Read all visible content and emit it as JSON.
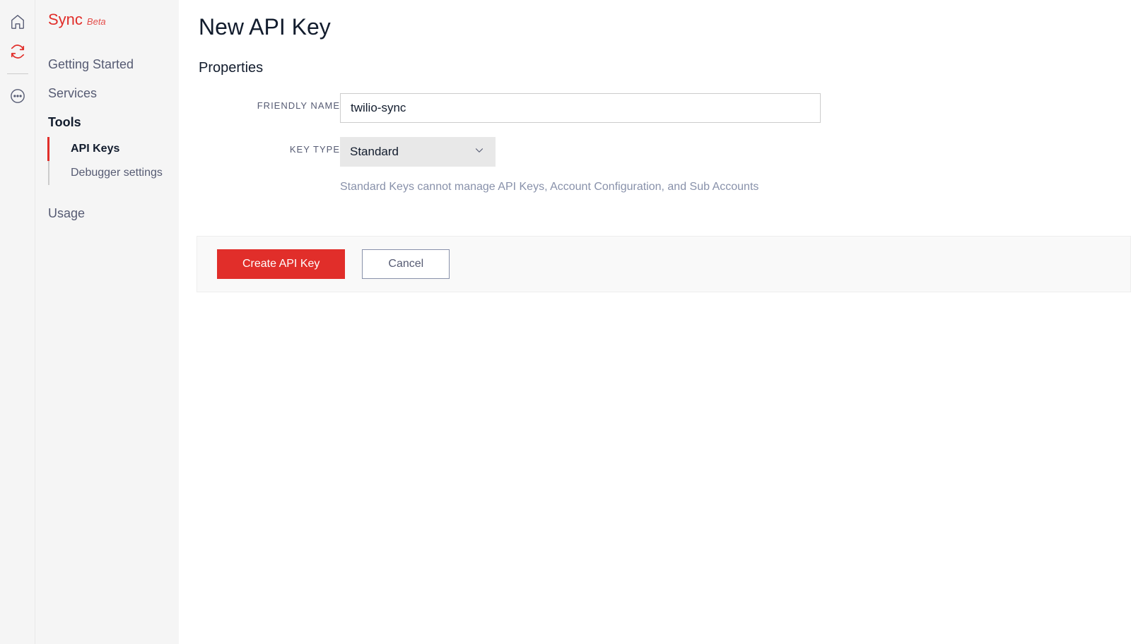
{
  "sidebar": {
    "title": "Sync",
    "badge": "Beta",
    "items": [
      {
        "label": "Getting Started"
      },
      {
        "label": "Services"
      },
      {
        "label": "Tools",
        "bold": true
      },
      {
        "label": "Usage"
      }
    ],
    "subitems": [
      {
        "label": "API Keys",
        "active": true
      },
      {
        "label": "Debugger settings"
      }
    ]
  },
  "page": {
    "title": "New API Key",
    "section": "Properties"
  },
  "form": {
    "friendly_name_label": "Friendly Name",
    "friendly_name_value": "twilio-sync",
    "key_type_label": "Key Type",
    "key_type_value": "Standard",
    "helper_text": "Standard Keys cannot manage API Keys, Account Configuration, and Sub Accounts"
  },
  "actions": {
    "create_label": "Create API Key",
    "cancel_label": "Cancel"
  }
}
